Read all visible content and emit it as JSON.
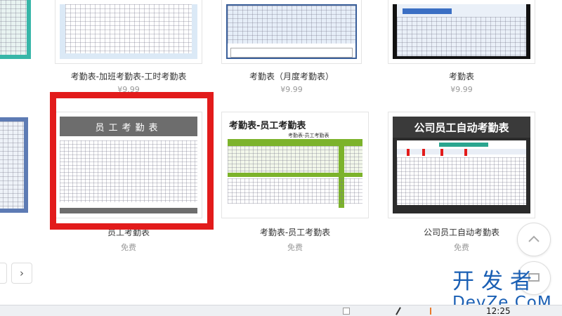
{
  "cards_row1": [
    {
      "title": "考勤表-加班考勤表-工时考勤表",
      "price": "¥9.99"
    },
    {
      "title": "考勤表（月度考勤表）",
      "price": "¥9.99"
    },
    {
      "title": "考勤表",
      "price": "¥9.99"
    }
  ],
  "cards_row2": [
    {
      "title": "员工考勤表",
      "price": "免费",
      "thumb_title": "员工考勤表"
    },
    {
      "title": "考勤表-员工考勤表",
      "price": "免费",
      "thumb_title": "考勤表-员工考勤表",
      "thumb_subtitle": "考勤表-员工考勤表"
    },
    {
      "title": "公司员工自动考勤表",
      "price": "免费",
      "thumb_title": "公司员工自动考勤表"
    }
  ],
  "pager": {
    "next": "›"
  },
  "scroll_top": {
    "icon": "chevron-up-icon"
  },
  "watermark": {
    "line1": "开发者",
    "line2": "DevZe.CoM"
  },
  "taskbar": {
    "time": "12:25"
  },
  "colors": {
    "highlight": "#e21b1b",
    "watermark": "#1a5fb4",
    "green": "#7cb32b"
  }
}
